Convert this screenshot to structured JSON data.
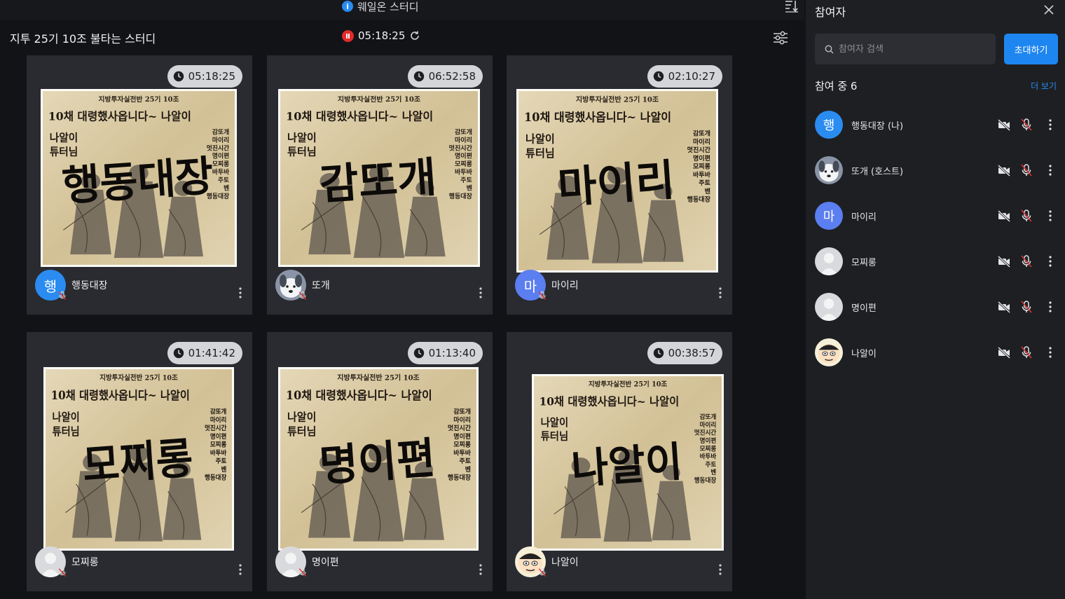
{
  "app": {
    "title": "웨일온 스터디",
    "info_icon": "i"
  },
  "study": {
    "name": "지투 25기 10조 불타는 스터디",
    "timer": "05:18:25"
  },
  "poster": {
    "header": "지방투자실전반 25기 10조",
    "headline": "10채  대령했사옵니다~ 나알이",
    "tutor": [
      "나알이",
      "튜터님"
    ],
    "roster": [
      "감또개",
      "마이리",
      "멋진시간",
      "명이편",
      "모찌롱",
      "바투바",
      "주토",
      "벤",
      "행동대장"
    ]
  },
  "cards": [
    {
      "timer": "05:18:25",
      "overlay": "행동대장",
      "name": "행동대장",
      "avatar_type": "letter",
      "avatar_letter": "행",
      "avatar_color": "#2a8cf0"
    },
    {
      "timer": "06:52:58",
      "overlay": "감또개",
      "name": "또개",
      "avatar_type": "dog"
    },
    {
      "timer": "02:10:27",
      "overlay": "마이리",
      "name": "마이리",
      "avatar_type": "letter",
      "avatar_letter": "마",
      "avatar_color": "#5b7ef0"
    },
    {
      "timer": "01:41:42",
      "overlay": "모찌롱",
      "name": "모찌롱",
      "avatar_type": "default"
    },
    {
      "timer": "01:13:40",
      "overlay": "명이편",
      "name": "명이편",
      "avatar_type": "default"
    },
    {
      "timer": "00:38:57",
      "overlay": "나알이",
      "name": "나알이",
      "avatar_type": "cartoon"
    }
  ],
  "panel": {
    "title": "참여자",
    "search_placeholder": "참여자 검색",
    "invite_label": "초대하기",
    "count_label": "참여 중 6",
    "more_label": "더 보기",
    "participants": [
      {
        "name": "행동대장 (나)",
        "avatar_type": "letter",
        "avatar_letter": "행",
        "avatar_color": "#2a8cf0",
        "camera": "camera-off-icon",
        "mic": "mic-off-icon"
      },
      {
        "name": "또개 (호스트)",
        "avatar_type": "dog",
        "camera": "camera-off-icon",
        "mic": "mic-off-icon"
      },
      {
        "name": "마이리",
        "avatar_type": "letter",
        "avatar_letter": "마",
        "avatar_color": "#5b7ef0",
        "camera": "camera-off-icon",
        "mic": "mic-off-icon"
      },
      {
        "name": "모찌롱",
        "avatar_type": "default",
        "camera": "camera-off-icon",
        "mic": "mic-off-icon"
      },
      {
        "name": "명이편",
        "avatar_type": "default",
        "camera": "camera-off-icon",
        "mic": "mic-off-icon"
      },
      {
        "name": "나알이",
        "avatar_type": "cartoon",
        "camera": "camera-off-icon",
        "mic": "mic-off-icon"
      }
    ]
  },
  "colors": {
    "accent": "#1e86f0",
    "record": "#e12b2b",
    "card_bg": "#2a2b30",
    "panel_bg": "#1e1f23"
  }
}
